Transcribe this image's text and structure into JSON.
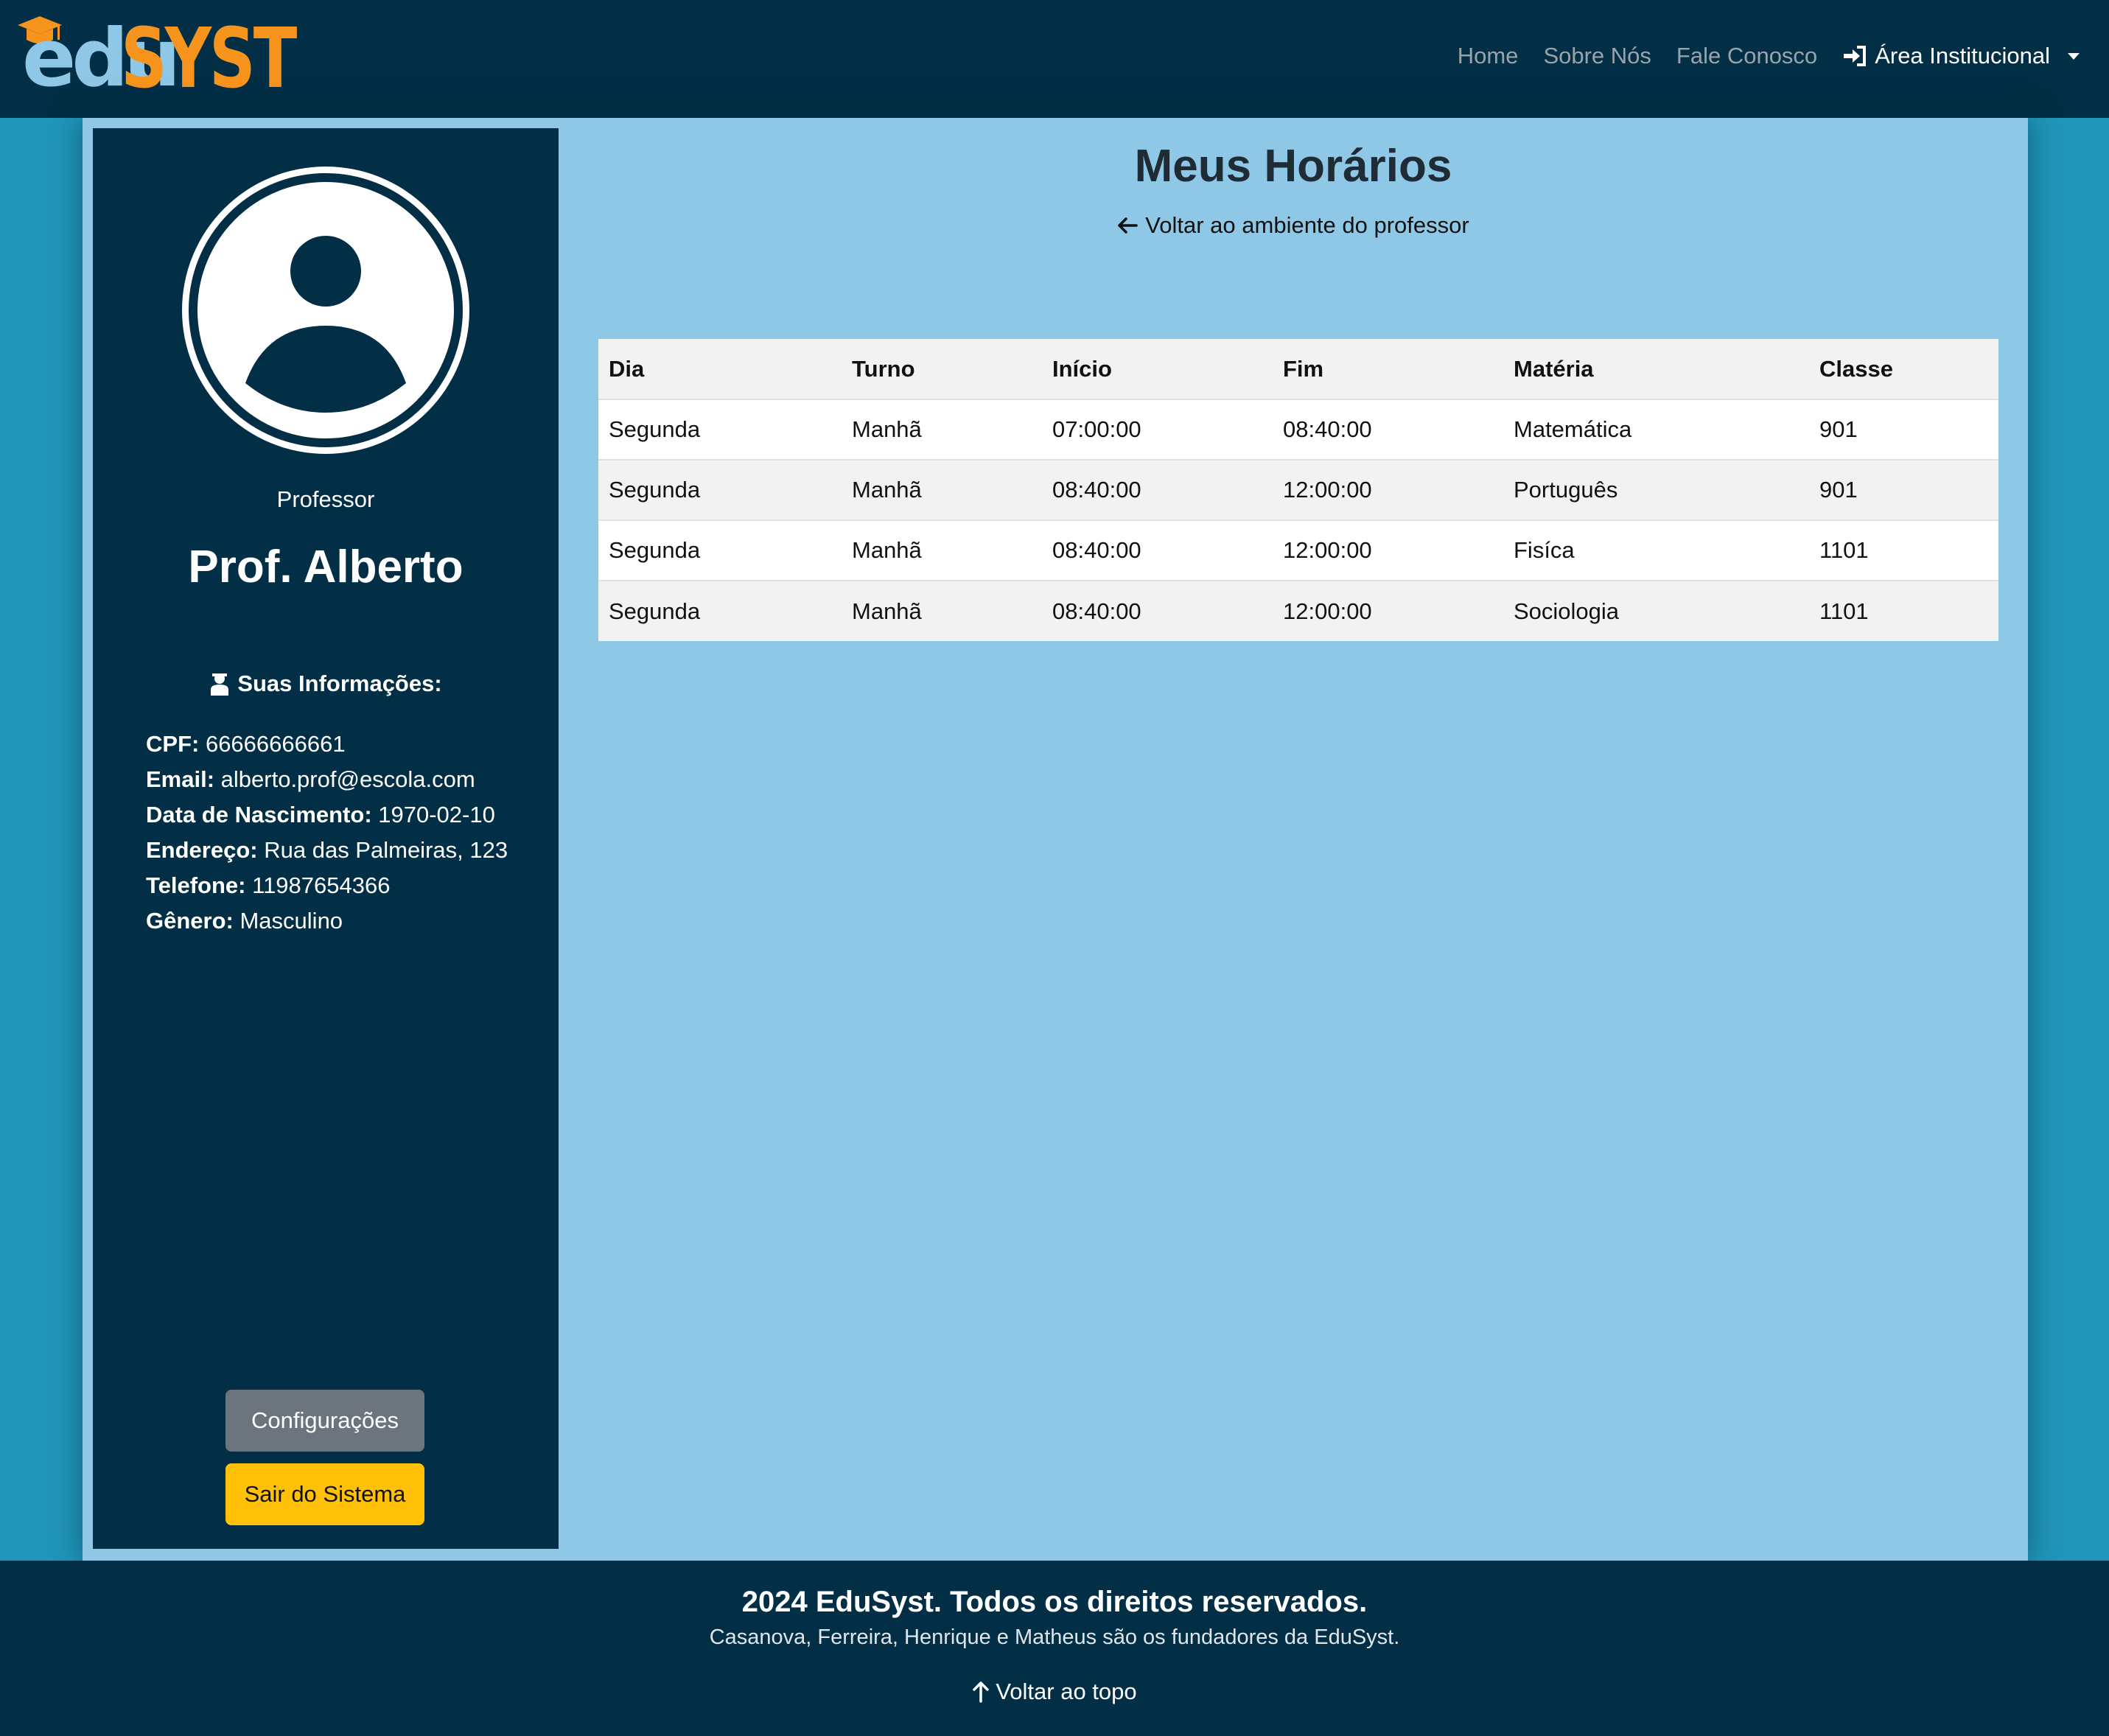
{
  "brand": {
    "part1": "edu",
    "part2": "SYST"
  },
  "nav": {
    "links": [
      "Home",
      "Sobre Nós",
      "Fale Conosco"
    ],
    "dropdown_label": "Área Institucional"
  },
  "profile": {
    "role": "Professor",
    "name": "Prof. Alberto",
    "info_title": "Suas Informações:",
    "fields": [
      {
        "label": "CPF:",
        "value": "66666666661"
      },
      {
        "label": "Email:",
        "value": "alberto.prof@escola.com"
      },
      {
        "label": "Data de Nascimento:",
        "value": "1970-02-10"
      },
      {
        "label": "Endereço:",
        "value": "Rua das Palmeiras, 123"
      },
      {
        "label": "Telefone:",
        "value": "11987654366"
      },
      {
        "label": "Gênero:",
        "value": "Masculino"
      }
    ],
    "config_button": "Configurações",
    "exit_button": "Sair do Sistema"
  },
  "content": {
    "title": "Meus Horários",
    "back_link": "Voltar ao ambiente do professor"
  },
  "schedule": {
    "headers": [
      "Dia",
      "Turno",
      "Início",
      "Fim",
      "Matéria",
      "Classe"
    ],
    "rows": [
      [
        "Segunda",
        "Manhã",
        "07:00:00",
        "08:40:00",
        "Matemática",
        "901"
      ],
      [
        "Segunda",
        "Manhã",
        "08:40:00",
        "12:00:00",
        "Português",
        "901"
      ],
      [
        "Segunda",
        "Manhã",
        "08:40:00",
        "12:00:00",
        "Fisíca",
        "1101"
      ],
      [
        "Segunda",
        "Manhã",
        "08:40:00",
        "12:00:00",
        "Sociologia",
        "1101"
      ]
    ]
  },
  "footer": {
    "title": "2024 EduSyst. Todos os direitos reservados.",
    "subtitle": "Casanova, Ferreira, Henrique e Matheus são os fundadores da EduSyst.",
    "back_to_top": "Voltar ao topo"
  },
  "colors": {
    "navy": "#022f45",
    "light_blue": "#8ec8e6",
    "teal": "#2096ba",
    "orange": "#f7941d",
    "yellow": "#ffc107",
    "gray": "#6c757d"
  }
}
